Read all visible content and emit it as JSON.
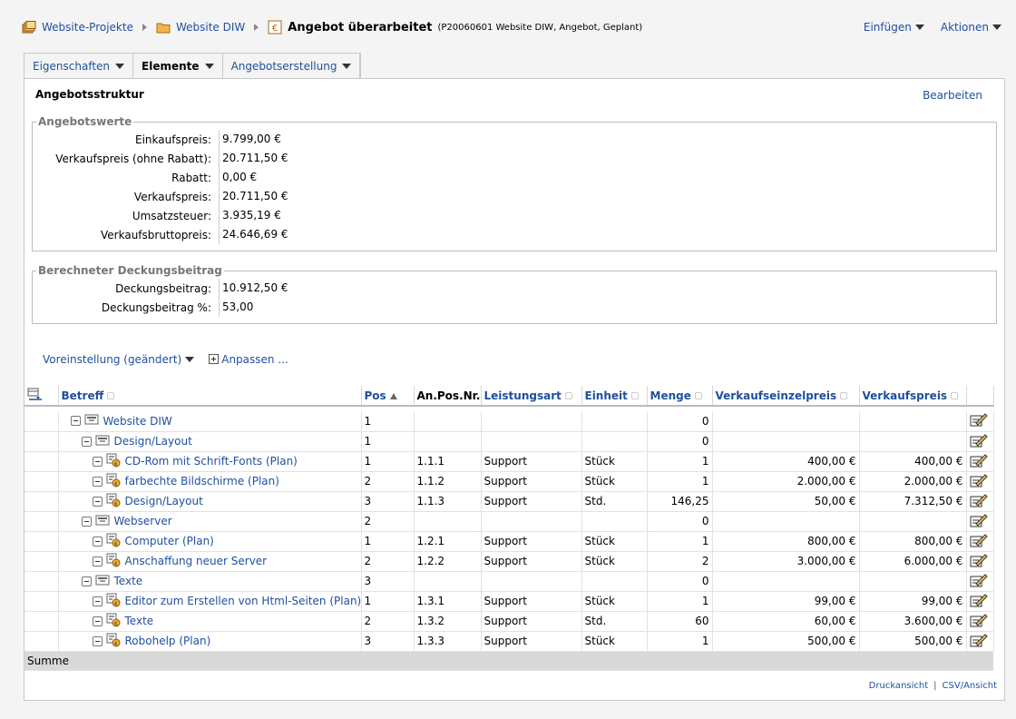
{
  "breadcrumb": {
    "items": [
      {
        "label": "Website-Projekte",
        "icon": "projects-icon"
      },
      {
        "label": "Website DIW",
        "icon": "folder-icon"
      }
    ],
    "current": {
      "title": "Angebot überarbeitet",
      "meta": "(P20060601 Website DIW, Angebot, Geplant)",
      "icon": "offer-icon"
    }
  },
  "top_actions": {
    "insert": "Einfügen",
    "actions": "Aktionen"
  },
  "tabs": [
    {
      "label": "Eigenschaften",
      "active": false
    },
    {
      "label": "Elemente",
      "active": true
    },
    {
      "label": "Angebotserstellung",
      "active": false
    }
  ],
  "panel": {
    "title": "Angebotsstruktur",
    "edit": "Bearbeiten"
  },
  "angebotswerte": {
    "legend": "Angebotswerte",
    "rows": [
      {
        "label": "Einkaufspreis:",
        "value": "9.799,00 €"
      },
      {
        "label": "Verkaufspreis (ohne Rabatt):",
        "value": "20.711,50 €"
      },
      {
        "label": "Rabatt:",
        "value": "0,00 €"
      },
      {
        "label": "Verkaufspreis:",
        "value": "20.711,50 €"
      },
      {
        "label": "Umsatzsteuer:",
        "value": "3.935,19 €"
      },
      {
        "label": "Verkaufsbruttopreis:",
        "value": "24.646,69 €"
      }
    ]
  },
  "deckungsbeitrag": {
    "legend": "Berechneter Deckungsbeitrag",
    "rows": [
      {
        "label": "Deckungsbeitrag:",
        "value": "10.912,50 €"
      },
      {
        "label": "Deckungsbeitrag %:",
        "value": "53,00"
      }
    ]
  },
  "view": {
    "preset": "Voreinstellung (geändert)",
    "customize": "Anpassen ..."
  },
  "table": {
    "columns": [
      "Betreff",
      "Pos",
      "An.Pos.Nr.",
      "Leistungsart",
      "Einheit",
      "Menge",
      "Verkaufseinzelpreis",
      "Verkaufspreis"
    ],
    "rows": [
      {
        "level": 0,
        "kind": "group",
        "betreff": "Website DIW",
        "pos": "1",
        "anpos": "",
        "art": "",
        "einheit": "",
        "menge": "0",
        "einzel": "",
        "preis": ""
      },
      {
        "level": 1,
        "kind": "group",
        "betreff": "Design/Layout",
        "pos": "1",
        "anpos": "",
        "art": "",
        "einheit": "",
        "menge": "0",
        "einzel": "",
        "preis": ""
      },
      {
        "level": 2,
        "kind": "item",
        "betreff": "CD-Rom mit Schrift-Fonts (Plan)",
        "pos": "1",
        "anpos": "1.1.1",
        "art": "Support",
        "einheit": "Stück",
        "menge": "1",
        "einzel": "400,00 €",
        "preis": "400,00 €"
      },
      {
        "level": 2,
        "kind": "item",
        "betreff": "farbechte Bildschirme (Plan)",
        "pos": "2",
        "anpos": "1.1.2",
        "art": "Support",
        "einheit": "Stück",
        "menge": "1",
        "einzel": "2.000,00 €",
        "preis": "2.000,00 €"
      },
      {
        "level": 2,
        "kind": "item",
        "betreff": "Design/Layout",
        "pos": "3",
        "anpos": "1.1.3",
        "art": "Support",
        "einheit": "Std.",
        "menge": "146,25",
        "einzel": "50,00 €",
        "preis": "7.312,50 €"
      },
      {
        "level": 1,
        "kind": "group",
        "betreff": "Webserver",
        "pos": "2",
        "anpos": "",
        "art": "",
        "einheit": "",
        "menge": "0",
        "einzel": "",
        "preis": ""
      },
      {
        "level": 2,
        "kind": "item",
        "betreff": "Computer (Plan)",
        "pos": "1",
        "anpos": "1.2.1",
        "art": "Support",
        "einheit": "Stück",
        "menge": "1",
        "einzel": "800,00 €",
        "preis": "800,00 €"
      },
      {
        "level": 2,
        "kind": "item",
        "betreff": "Anschaffung neuer Server",
        "pos": "2",
        "anpos": "1.2.2",
        "art": "Support",
        "einheit": "Stück",
        "menge": "2",
        "einzel": "3.000,00 €",
        "preis": "6.000,00 €"
      },
      {
        "level": 1,
        "kind": "group",
        "betreff": "Texte",
        "pos": "3",
        "anpos": "",
        "art": "",
        "einheit": "",
        "menge": "0",
        "einzel": "",
        "preis": ""
      },
      {
        "level": 2,
        "kind": "item",
        "betreff": "Editor zum Erstellen von Html-Seiten (Plan)",
        "pos": "1",
        "anpos": "1.3.1",
        "art": "Support",
        "einheit": "Stück",
        "menge": "1",
        "einzel": "99,00 €",
        "preis": "99,00 €"
      },
      {
        "level": 2,
        "kind": "item",
        "betreff": "Texte",
        "pos": "2",
        "anpos": "1.3.2",
        "art": "Support",
        "einheit": "Std.",
        "menge": "60",
        "einzel": "60,00 €",
        "preis": "3.600,00 €"
      },
      {
        "level": 2,
        "kind": "item",
        "betreff": "Robohelp (Plan)",
        "pos": "3",
        "anpos": "1.3.3",
        "art": "Support",
        "einheit": "Stück",
        "menge": "1",
        "einzel": "500,00 €",
        "preis": "500,00 €"
      }
    ],
    "sum_label": "Summe"
  },
  "footer": {
    "print": "Druckansicht",
    "csv": "CSV/Ansicht"
  },
  "colors": {
    "link": "#1f4f9e",
    "sum_row": "#d9d9d9"
  }
}
